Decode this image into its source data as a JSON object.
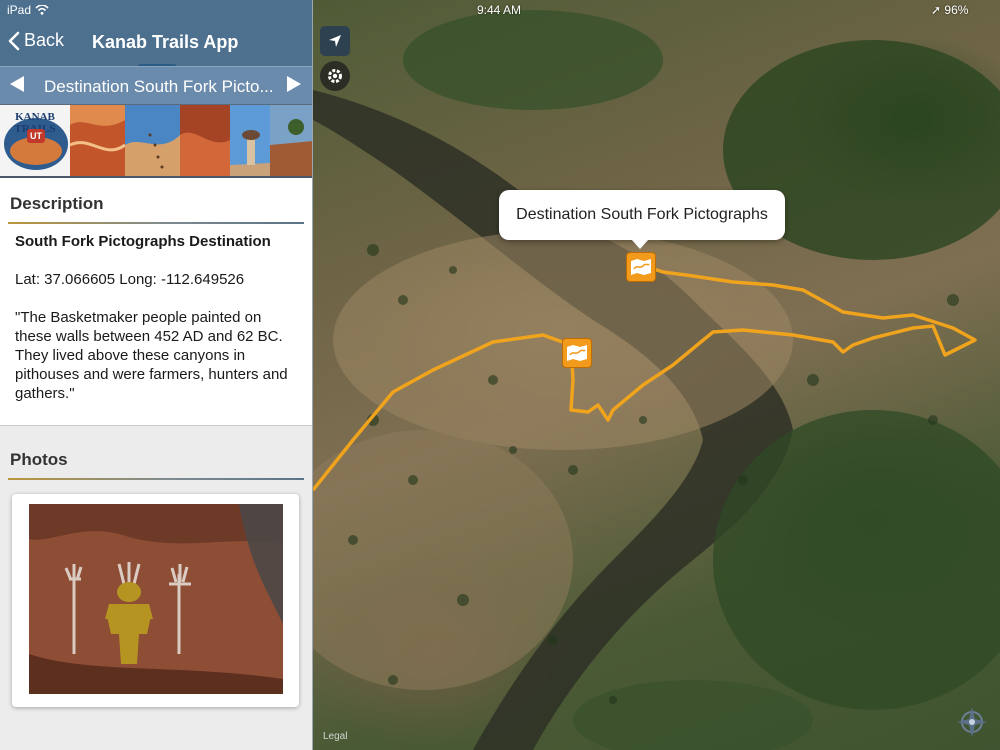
{
  "status_bar": {
    "device": "iPad",
    "time": "9:44 AM",
    "battery": "96%"
  },
  "nav": {
    "back_label": "Back",
    "title": "Kanab Trails App"
  },
  "destination_bar": {
    "title": "Destination South Fork Picto..."
  },
  "banner": {
    "logo_text": "KANAB TRAILS",
    "logo_badge": "UT"
  },
  "description": {
    "heading": "Description",
    "title": "South Fork Pictographs Destination",
    "lat_long": "Lat: 37.066605 Long: -112.649526",
    "body": "\"The Basketmaker people painted on these walls between 452 AD and 62 BC. They lived above these canyons in pithouses and were farmers, hunters and gathers.\""
  },
  "photos": {
    "heading": "Photos"
  },
  "map": {
    "callout": "Destination South Fork Pictographs",
    "legal": "Legal",
    "trail_color": "#f0a31c",
    "marker_color": "#f29a1b"
  },
  "icons": {
    "back": "chevron-left-icon",
    "prev": "triangle-left-icon",
    "next": "triangle-right-icon",
    "locate": "location-arrow-icon",
    "settings": "gear-icon",
    "marker": "map-marker-icon",
    "compass": "compass-icon"
  }
}
